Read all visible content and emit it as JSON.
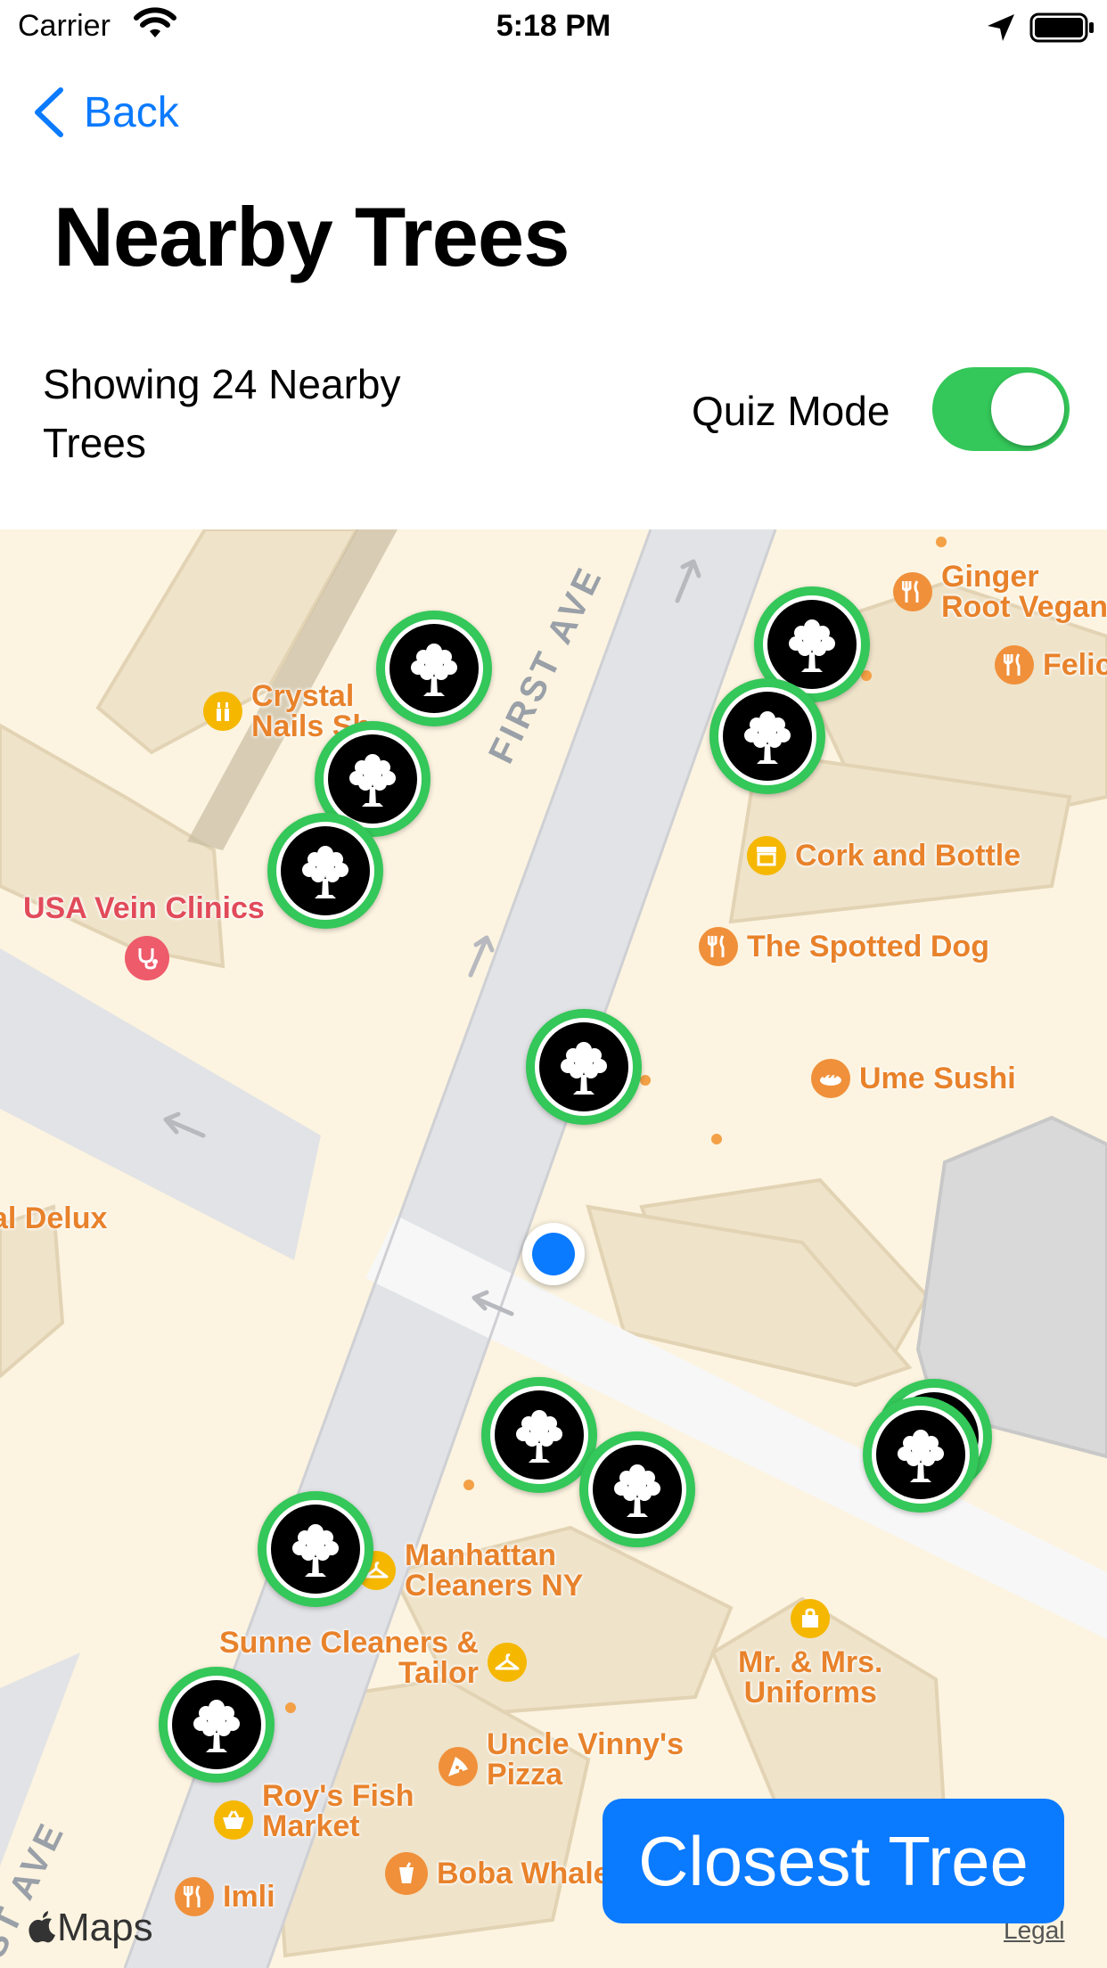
{
  "status_bar": {
    "carrier": "Carrier",
    "time": "5:18 PM"
  },
  "nav": {
    "back_label": "Back"
  },
  "page": {
    "title": "Nearby Trees",
    "showing_text": "Showing 24 Nearby Trees",
    "quiz_mode_label": "Quiz Mode",
    "quiz_mode_on": true
  },
  "map": {
    "streets": [
      "FIRST AVE",
      "ST AVE"
    ],
    "pois": [
      {
        "name": "Ginger Root Vegan",
        "line1": "Ginger",
        "line2": "Root Vegan",
        "icon": "fork-knife-icon"
      },
      {
        "name": "Felic",
        "icon": "fork-knife-icon"
      },
      {
        "name": "Crystal Nails Sh",
        "line1": "Crystal",
        "line2": "Nails Sh",
        "icon": "nails-icon"
      },
      {
        "name": "USA Vein Clinics",
        "icon": "stethoscope-icon"
      },
      {
        "name": "Cork and Bottle",
        "icon": "store-icon"
      },
      {
        "name": "The Spotted Dog",
        "icon": "fork-knife-icon"
      },
      {
        "name": "Ume Sushi",
        "icon": "sushi-icon"
      },
      {
        "name": "al Delux",
        "icon": ""
      },
      {
        "name": "Manhattan Cleaners NY",
        "line1": "Manhattan",
        "line2": "Cleaners NY",
        "icon": "hanger-icon"
      },
      {
        "name": "Sunne Cleaners & Tailor",
        "line1": "Sunne Cleaners &",
        "line2": "Tailor",
        "icon": "hanger-icon"
      },
      {
        "name": "Mr. & Mrs. Uniforms",
        "line1": "Mr. & Mrs.",
        "line2": "Uniforms",
        "icon": "bag-icon"
      },
      {
        "name": "Uncle Vinny's Pizza",
        "line1": "Uncle Vinny's",
        "line2": "Pizza",
        "icon": "pizza-icon"
      },
      {
        "name": "Roy's Fish Market",
        "line1": "Roy's Fish",
        "line2": "Market",
        "icon": "basket-icon"
      },
      {
        "name": "Boba Whale",
        "icon": "cup-icon"
      },
      {
        "name": "Imli",
        "icon": "fork-knife-icon"
      }
    ],
    "attribution": "Maps",
    "legal": "Legal"
  },
  "actions": {
    "closest_tree": "Closest Tree"
  },
  "colors": {
    "accent": "#0a7aff",
    "toggle_on": "#34c759",
    "tree_ring": "#34c759",
    "poi_orange": "#e8822b",
    "poi_red": "#e14b5a"
  }
}
